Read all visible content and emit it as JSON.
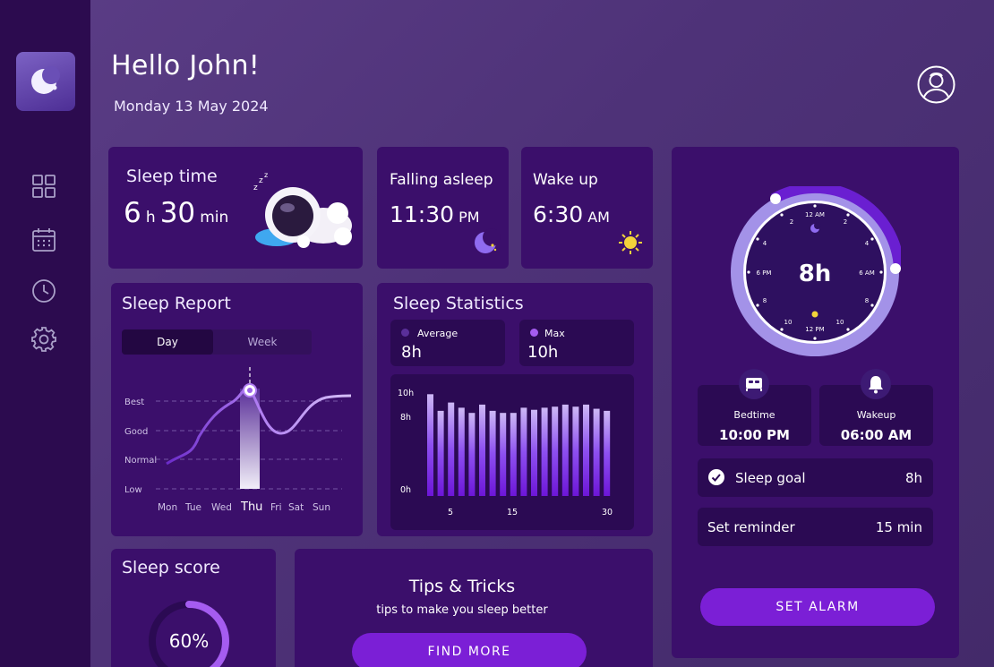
{
  "greeting": "Hello John!",
  "date": "Monday 13 May 2024",
  "nav": {
    "items": [
      "dashboard-icon",
      "calendar-icon",
      "clock-icon",
      "settings-icon"
    ]
  },
  "sleep_time": {
    "label": "Sleep time",
    "hours": "6",
    "h_unit": "h",
    "minutes": "30",
    "min_unit": "min"
  },
  "falling_asleep": {
    "label": "Falling asleep",
    "time": "11:30",
    "ampm": "PM"
  },
  "wake_up": {
    "label": "Wake up",
    "time": "6:30",
    "ampm": "AM"
  },
  "sleep_report": {
    "title": "Sleep Report",
    "tabs": [
      "Day",
      "Week"
    ],
    "active_tab": "Day",
    "levels": [
      "Best",
      "Good",
      "Normal",
      "Low"
    ],
    "days": [
      "Mon",
      "Tue",
      "Wed",
      "Thu",
      "Fri",
      "Sat",
      "Sun"
    ],
    "selected_day": "Thu"
  },
  "sleep_statistics": {
    "title": "Sleep Statistics",
    "average_label": "Average",
    "average_value": "8h",
    "max_label": "Max",
    "max_value": "10h"
  },
  "chart_data": {
    "type": "bar",
    "yticks": [
      "10h",
      "8h",
      "0h"
    ],
    "xticks": [
      "5",
      "15",
      "30"
    ],
    "ylim": [
      0,
      10
    ],
    "x": [
      1,
      2,
      3,
      4,
      5,
      6,
      7,
      8,
      9,
      10,
      11,
      12,
      13,
      14,
      15,
      16,
      17,
      18
    ],
    "values": [
      9.8,
      8.2,
      9.0,
      8.5,
      8.0,
      8.8,
      8.2,
      8.0,
      8.0,
      8.5,
      8.3,
      8.5,
      8.6,
      8.8,
      8.6,
      8.8,
      8.4,
      8.2
    ]
  },
  "sleep_score": {
    "title": "Sleep score",
    "value": "60%",
    "fraction": 0.6
  },
  "tips": {
    "title": "Tips & Tricks",
    "subtitle": "tips to make you sleep better",
    "button": "FIND MORE"
  },
  "clock": {
    "center": "8h",
    "labels": [
      "12 AM",
      "2",
      "4",
      "6 AM",
      "8",
      "10",
      "12 PM",
      "10",
      "8",
      "6 PM",
      "4",
      "2"
    ]
  },
  "bedtime": {
    "label": "Bedtime",
    "time": "10:00 PM"
  },
  "wakeup": {
    "label": "Wakeup",
    "time": "06:00 AM"
  },
  "sleep_goal": {
    "label": "Sleep goal",
    "value": "8h"
  },
  "reminder": {
    "label": "Set reminder",
    "value": "15 min"
  },
  "set_alarm": "SET ALARM",
  "colors": {
    "accent": "#7b1fd6",
    "card": "#3b0f6b",
    "sidebar": "#2c0b4f",
    "moon": "#8f6bf0",
    "sun": "#f3d33a"
  }
}
